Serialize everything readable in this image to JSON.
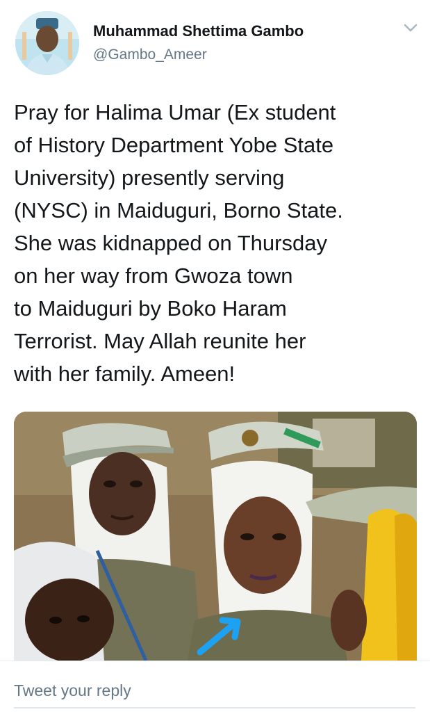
{
  "tweet": {
    "author": {
      "display_name": "Muhammad Shettima Gambo",
      "handle": "@Gambo_Ameer",
      "avatar_icon": "user-avatar-photo"
    },
    "menu_icon": "chevron-down-icon",
    "text_lines": [
      "Pray for Halima Umar (Ex student",
      "of History Department Yobe State",
      "University)  presently serving",
      "(NYSC) in Maiduguri, Borno State.",
      "She was kidnapped on Thursday",
      "on her way from Gwoza town",
      "to Maiduguri by Boko Haram",
      "Terrorist. May Allah reunite her",
      "with her family. Ameen!"
    ],
    "media": {
      "type": "photo",
      "description_icon": "attached-photo",
      "arrow_color": "#1da1f2"
    }
  },
  "reply": {
    "placeholder": "Tweet your reply",
    "value": ""
  },
  "colors": {
    "text": "#14171a",
    "secondary": "#657786",
    "accent": "#1da1f2",
    "divider": "#e6ecf0"
  }
}
